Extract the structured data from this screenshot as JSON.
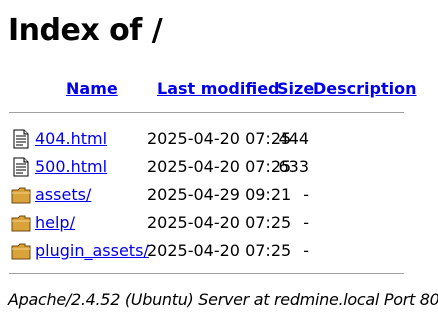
{
  "page": {
    "title": "Index of /"
  },
  "columns": {
    "name": "Name",
    "last_modified": "Last modified",
    "size": "Size",
    "description": "Description"
  },
  "entries": [
    {
      "icon": "text-file-icon",
      "name": "404.html",
      "modified": "2025-04-20 07:25",
      "size": "444",
      "description": ""
    },
    {
      "icon": "text-file-icon",
      "name": "500.html",
      "modified": "2025-04-20 07:25",
      "size": "633",
      "description": ""
    },
    {
      "icon": "folder-icon",
      "name": "assets/",
      "modified": "2025-04-29 09:21",
      "size": "-",
      "description": ""
    },
    {
      "icon": "folder-icon",
      "name": "help/",
      "modified": "2025-04-20 07:25",
      "size": "-",
      "description": ""
    },
    {
      "icon": "folder-icon",
      "name": "plugin_assets/",
      "modified": "2025-04-20 07:25",
      "size": "-",
      "description": ""
    }
  ],
  "footer": {
    "address": "Apache/2.4.52 (Ubuntu) Server at redmine.local Port 80"
  },
  "colors": {
    "link": "#0000ee",
    "rule": "#a0a0a0",
    "folder": "#d9a23a"
  }
}
